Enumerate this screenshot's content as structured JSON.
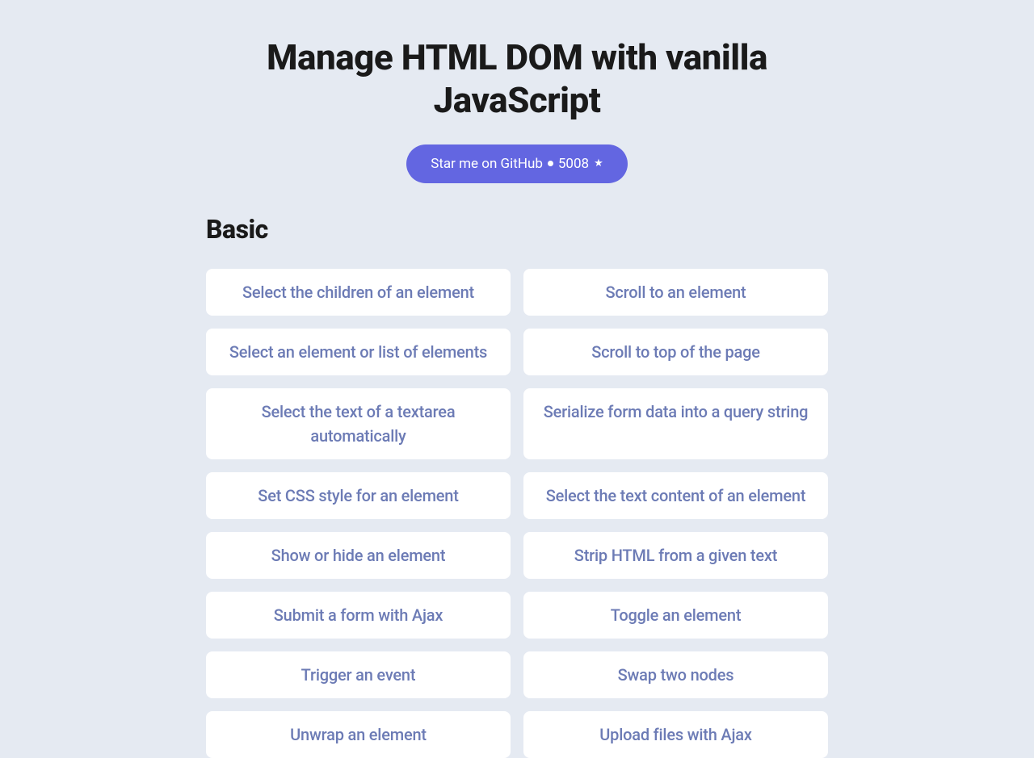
{
  "header": {
    "title": "Manage HTML DOM with vanilla JavaScript",
    "github": {
      "label": "Star me on GitHub",
      "stars": "5008"
    }
  },
  "section": {
    "heading": "Basic",
    "cards": [
      {
        "label": "Select the children of an element"
      },
      {
        "label": "Scroll to an element"
      },
      {
        "label": "Select an element or list of elements"
      },
      {
        "label": "Scroll to top of the page"
      },
      {
        "label": "Select the text of a textarea automatically"
      },
      {
        "label": "Serialize form data into a query string"
      },
      {
        "label": "Set CSS style for an element"
      },
      {
        "label": "Select the text content of an element"
      },
      {
        "label": "Show or hide an element"
      },
      {
        "label": "Strip HTML from a given text"
      },
      {
        "label": "Submit a form with Ajax"
      },
      {
        "label": "Toggle an element"
      },
      {
        "label": "Trigger an event"
      },
      {
        "label": "Swap two nodes"
      },
      {
        "label": "Unwrap an element"
      },
      {
        "label": "Upload files with Ajax"
      }
    ]
  }
}
